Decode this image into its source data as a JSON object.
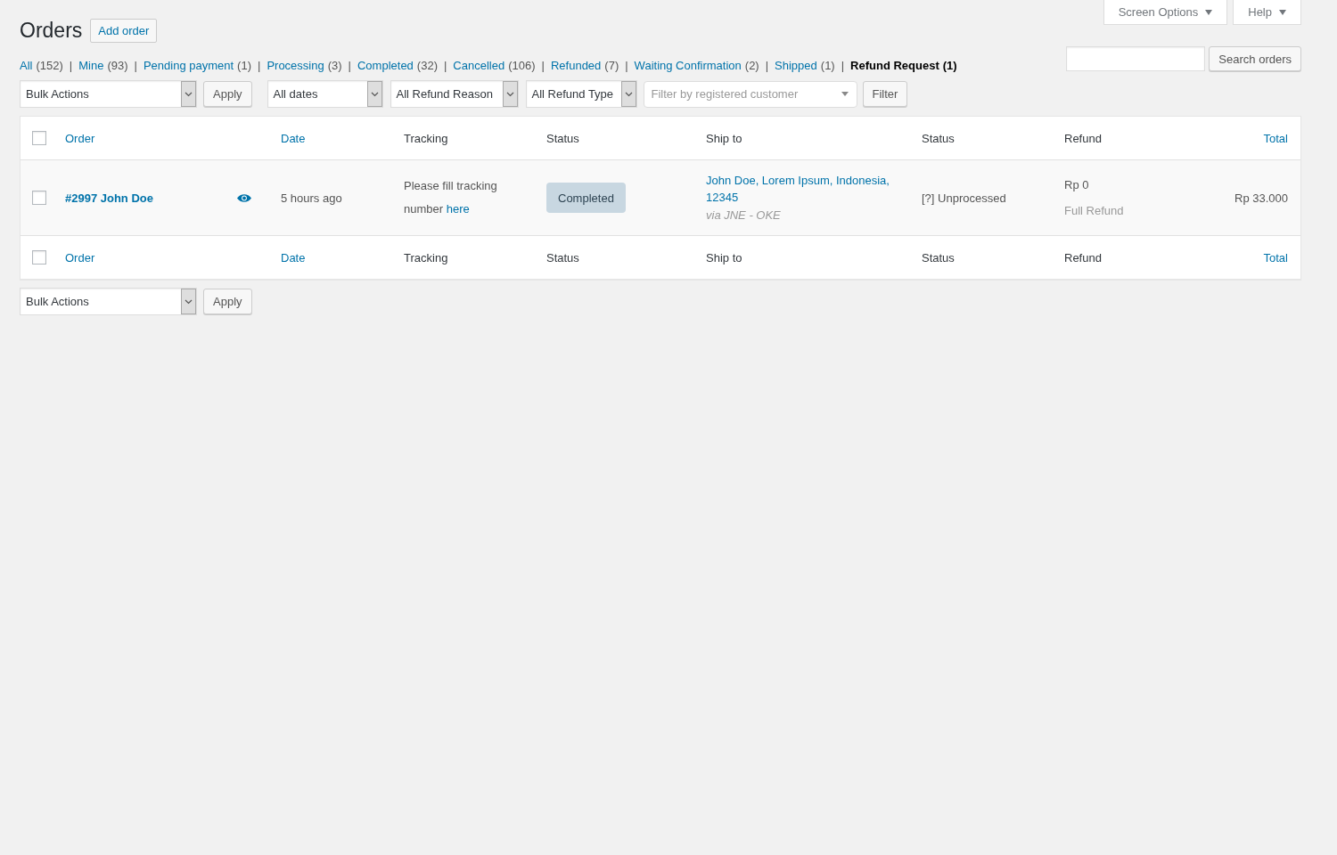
{
  "screen_meta": [
    {
      "label": "Screen Options",
      "expanded": false
    },
    {
      "label": "Help",
      "expanded": false
    }
  ],
  "title": "Orders",
  "add_button": "Add order",
  "views": [
    {
      "label": "All",
      "count": "(152)",
      "selected": false,
      "separator": "|"
    },
    {
      "label": "Mine",
      "count": "(93)",
      "selected": false,
      "separator": "|"
    },
    {
      "label": "Pending payment",
      "count": "(1)",
      "selected": false,
      "separator": "|"
    },
    {
      "label": "Processing",
      "count": "(3)",
      "selected": false,
      "separator": "|"
    },
    {
      "label": "Completed",
      "count": "(32)",
      "selected": false,
      "separator": "|"
    },
    {
      "label": "Cancelled",
      "count": "(106)",
      "selected": false,
      "separator": "|"
    },
    {
      "label": "Refunded",
      "count": "(7)",
      "selected": false,
      "separator": "|"
    },
    {
      "label": "Waiting Confirmation",
      "count": "(2)",
      "selected": false,
      "separator": "|"
    },
    {
      "label": "Shipped",
      "count": "(1)",
      "selected": false,
      "separator": "|"
    },
    {
      "label": "Refund Request",
      "count": "(1)",
      "selected": true
    }
  ],
  "search": {
    "button": "Search orders"
  },
  "top_actions": {
    "bulk": "Bulk Actions",
    "apply": "Apply",
    "filters": [
      "All dates",
      "All Refund Reason",
      "All Refund Type"
    ],
    "customer": {
      "placeholder": "Filter by registered customer"
    },
    "filter_button": "Filter"
  },
  "table": {
    "header_checkbox": {
      "checked": false
    },
    "columns": [
      {
        "label": "Order",
        "sortable": true
      },
      {
        "label": "Date",
        "sortable": true
      },
      {
        "label": "Tracking",
        "sortable": false
      },
      {
        "label": "Status",
        "sortable": false
      },
      {
        "label": "Ship to",
        "sortable": false
      },
      {
        "label": "Status",
        "sortable": false
      },
      {
        "label": "Refund",
        "sortable": false
      },
      {
        "label": "Total",
        "sortable": true
      }
    ],
    "rows": [
      {
        "checked": false,
        "order": "#2997 John Doe",
        "date": "5 hours ago",
        "tracking": {
          "text": "Please fill tracking number",
          "link": "here"
        },
        "status": {
          "label": "Completed",
          "kind": "completed"
        },
        "ship_to": {
          "address": "John Doe, Lorem Ipsum, Indonesia, 12345",
          "method": "via JNE - OKE"
        },
        "refund_status": "[?] Unprocessed",
        "refund": {
          "amount": "Rp 0",
          "type": "Full Refund"
        },
        "total": "Rp 33.000"
      }
    ],
    "footer_checkbox": {
      "checked": false
    },
    "footer_columns": [
      {
        "label": "Order",
        "sortable": true
      },
      {
        "label": "Date",
        "sortable": true
      },
      {
        "label": "Tracking",
        "sortable": false
      },
      {
        "label": "Status",
        "sortable": false
      },
      {
        "label": "Ship to",
        "sortable": false
      },
      {
        "label": "Status",
        "sortable": false
      },
      {
        "label": "Refund",
        "sortable": false
      },
      {
        "label": "Total",
        "sortable": true
      }
    ]
  },
  "bottom_actions": {
    "bulk": "Bulk Actions",
    "apply": "Apply"
  }
}
